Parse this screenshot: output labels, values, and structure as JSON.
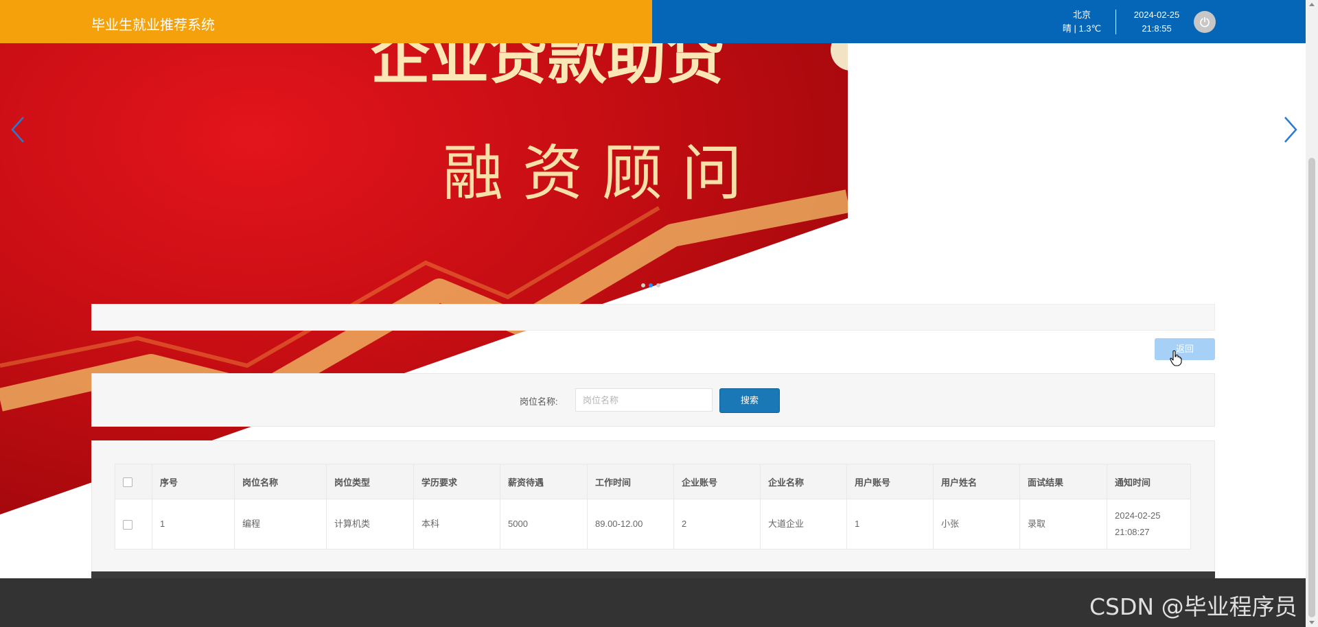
{
  "header": {
    "title": "毕业生就业推荐系统",
    "city": "北京",
    "weather": "晴 | 1.3℃",
    "date": "2024-02-25",
    "time": "21:8:55",
    "power_icon": "power-icon",
    "colors": {
      "left": "#f4a10b",
      "right": "#0565b6"
    }
  },
  "banner": {
    "line1": "企业贷款助贷",
    "line2": "融 资 顾 问",
    "prev_icon": "chevron-left-icon",
    "next_icon": "chevron-right-icon",
    "dots": 3,
    "active_dot": 1
  },
  "actions": {
    "back_label": "返回"
  },
  "search": {
    "label": "岗位名称:",
    "placeholder": "岗位名称",
    "value": "",
    "button": "搜索"
  },
  "table": {
    "columns": [
      "序号",
      "岗位名称",
      "岗位类型",
      "学历要求",
      "薪资待遇",
      "工作时间",
      "企业账号",
      "企业名称",
      "用户账号",
      "用户姓名",
      "面试结果",
      "通知时间"
    ],
    "rows": [
      [
        "1",
        "编程",
        "计算机类",
        "本科",
        "5000",
        "89.00-12.00",
        "2",
        "大道企业",
        "1",
        "小张",
        "录取",
        "2024-02-25 21:08:27"
      ]
    ]
  },
  "watermark": "CSDN @毕业程序员"
}
